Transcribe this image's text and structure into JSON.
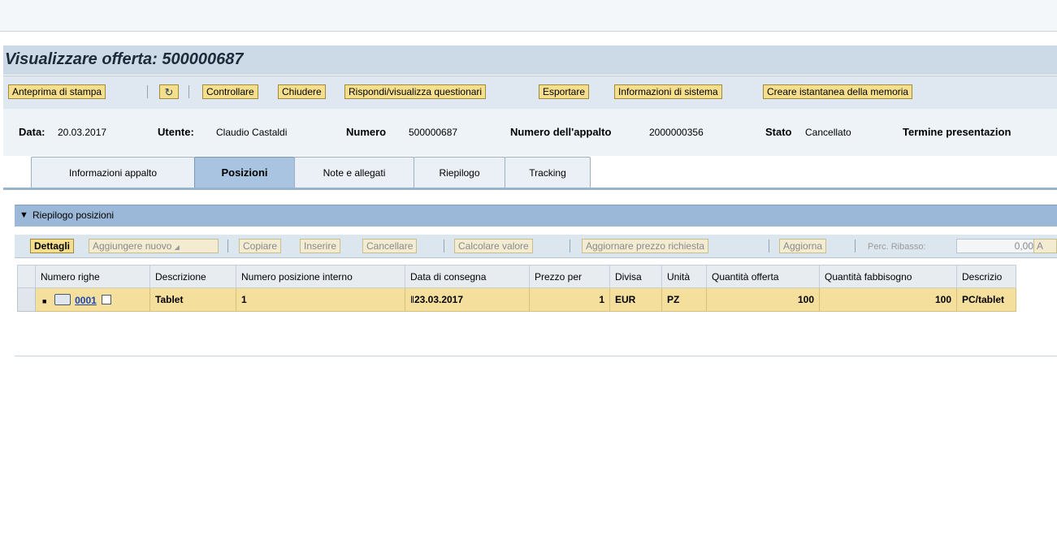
{
  "page_title": "Visualizzare offerta: 500000687",
  "toolbar": {
    "print_preview": "Anteprima di stampa",
    "check": "Controllare",
    "close": "Chiudere",
    "questionnaire": "Rispondi/visualizza questionari",
    "export": "Esportare",
    "system_info": "Informazioni di sistema",
    "memory_snapshot": "Creare istantanea della memoria"
  },
  "header_info": {
    "date_label": "Data:",
    "date_value": "20.03.2017",
    "user_label": "Utente:",
    "user_value": "Claudio Castaldi",
    "number_label": "Numero",
    "number_value": "500000687",
    "tender_label": "Numero dell'appalto",
    "tender_value": "2000000356",
    "status_label": "Stato",
    "status_value": "Cancellato",
    "deadline_label": "Termine presentazion"
  },
  "tabs": [
    {
      "label": "Informazioni appalto",
      "active": false
    },
    {
      "label": "Posizioni",
      "active": true
    },
    {
      "label": "Note e allegati",
      "active": false
    },
    {
      "label": "Riepilogo",
      "active": false
    },
    {
      "label": "Tracking",
      "active": false
    }
  ],
  "section": {
    "title": "Riepilogo posizioni"
  },
  "grid_toolbar": {
    "details": "Dettagli",
    "add_new": "Aggiungere nuovo",
    "copy": "Copiare",
    "insert": "Inserire",
    "delete": "Cancellare",
    "calc_value": "Calcolare valore",
    "update_price": "Aggiornare prezzo richiesta",
    "refresh": "Aggiorna",
    "discount_label": "Perc. Ribasso:",
    "discount_value": "0,00",
    "apply_partial": "A"
  },
  "grid": {
    "columns": [
      "Numero righe",
      "Descrizione",
      "Numero posizione interno",
      "Data di consegna",
      "Prezzo per",
      "Divisa",
      "Unità",
      "Quantità offerta",
      "Quantità fabbisogno",
      "Descrizio"
    ],
    "rows": [
      {
        "line_number": "0001",
        "description": "Tablet",
        "internal_position": "1",
        "delivery_date": "23.03.2017",
        "price_per": "1",
        "currency": "EUR",
        "unit": "PZ",
        "offer_qty": "100",
        "required_qty": "100",
        "category": "PC/tablet"
      }
    ]
  },
  "colors": {
    "button_bg": "#f6df8c",
    "section_header": "#9bb8d8",
    "row_highlight": "#f5df9c",
    "active_tab": "#a9c4e0"
  }
}
